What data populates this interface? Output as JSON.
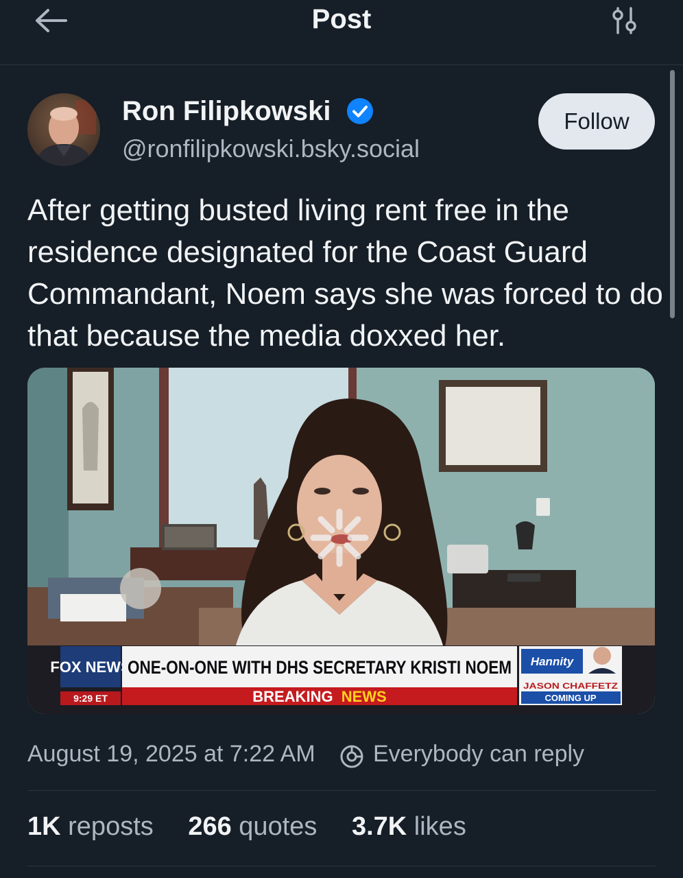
{
  "header": {
    "title": "Post"
  },
  "author": {
    "name": "Ron Filipkowski",
    "handle": "@ronfilipkowski.bsky.social",
    "verified": true
  },
  "follow_label": "Follow",
  "post": {
    "text": "After getting busted living rent free in the residence designated for the Coast Guard Commandant, Noem says she was forced to do that because the media doxxed her."
  },
  "media": {
    "type": "video",
    "lower_third": {
      "network": "FOX NEWS",
      "time": "9:29 ET",
      "headline": "ONE-ON-ONE WITH DHS SECRETARY KRISTI NOEM",
      "breaking": "BREAKING",
      "news": "NEWS",
      "promo_show": "Hannity",
      "promo_guest": "JASON CHAFFETZ",
      "promo_status": "COMING UP"
    }
  },
  "meta": {
    "timestamp": "August 19, 2025 at 7:22 AM",
    "reply_setting": "Everybody can reply"
  },
  "stats": [
    {
      "value": "1K",
      "label": "reposts"
    },
    {
      "value": "266",
      "label": "quotes"
    },
    {
      "value": "3.7K",
      "label": "likes"
    }
  ],
  "colors": {
    "background": "#161e27",
    "accent_blue": "#1083fe",
    "follow_button_bg": "#e3e8ee",
    "muted_text": "#aeb7c1"
  },
  "icons": [
    "back-arrow-icon",
    "filter-sliders-icon",
    "verified-badge-icon",
    "loading-spinner-icon",
    "reply-settings-icon"
  ]
}
